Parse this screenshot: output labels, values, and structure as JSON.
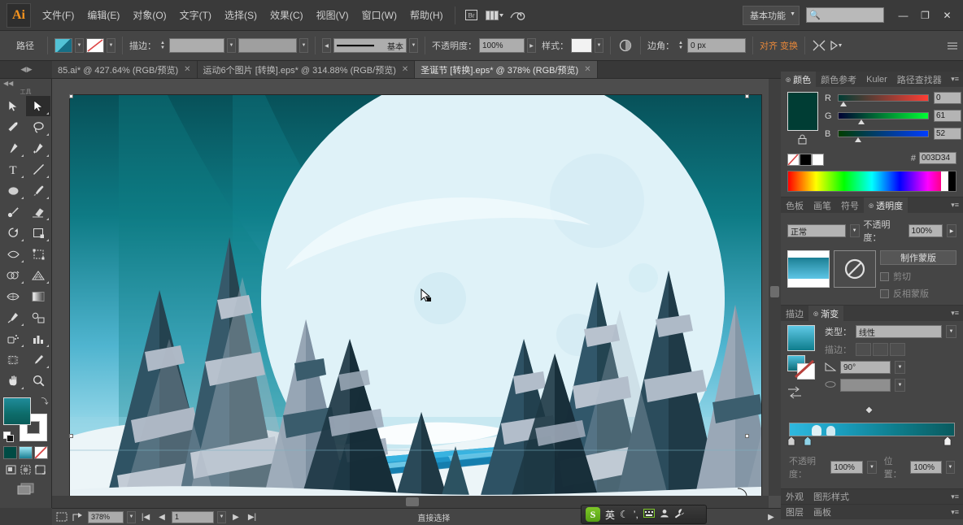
{
  "app": {
    "name": "Ai",
    "workspace": "基本功能",
    "search_placeholder": ""
  },
  "menubar": {
    "items": [
      {
        "label": "文件(F)"
      },
      {
        "label": "编辑(E)"
      },
      {
        "label": "对象(O)"
      },
      {
        "label": "文字(T)"
      },
      {
        "label": "选择(S)"
      },
      {
        "label": "效果(C)"
      },
      {
        "label": "视图(V)"
      },
      {
        "label": "窗口(W)"
      },
      {
        "label": "帮助(H)"
      }
    ],
    "bridge_icon": "bridge-icon",
    "arrange_icon": "arrange-documents-icon",
    "stock_icon": "stock-icon",
    "window_buttons": {
      "minimize": "—",
      "restore": "❐",
      "close": "✕"
    }
  },
  "controlbar": {
    "object_label": "路径",
    "fill_color": "#2a8f9e",
    "stroke_icon": "stroke-none-icon",
    "stroke_weight_label": "描边：",
    "stroke_weight_value": "",
    "profile_value": "",
    "brush_label": "",
    "brush_value": "基本",
    "opacity_label": "不透明度：",
    "opacity_value": "100%",
    "style_label": "样式：",
    "style_value": "",
    "recolor_icon": "recolor-artwork-icon",
    "corner_label": "边角：",
    "corner_value": "0 px",
    "align_label": "对齐",
    "transform_label": "变换",
    "isolate_icon": "isolate-selected-icon",
    "mask_icon": "draw-mode-icon",
    "panel_menu_icon": "panel-menu-icon"
  },
  "tabs": [
    {
      "title": "85.ai* @ 427.64% (RGB/预览)",
      "active": false,
      "close": "✕"
    },
    {
      "title": "运动6个图片 [转换].eps* @ 314.88% (RGB/预览)",
      "active": false,
      "close": "✕"
    },
    {
      "title": "圣诞节 [转换].eps* @ 378% (RGB/预览)",
      "active": true,
      "close": "✕"
    }
  ],
  "toolbox": {
    "title": "工具",
    "tools": [
      {
        "name": "selection-tool",
        "glyph": "selection",
        "selected": false
      },
      {
        "name": "direct-selection-tool",
        "glyph": "direct-selection",
        "selected": true
      },
      {
        "name": "magic-wand-tool",
        "glyph": "magic-wand",
        "selected": false
      },
      {
        "name": "lasso-tool",
        "glyph": "lasso",
        "selected": false
      },
      {
        "name": "pen-tool",
        "glyph": "pen",
        "selected": false
      },
      {
        "name": "add-anchor-point-tool",
        "glyph": "pen-add",
        "selected": false
      },
      {
        "name": "type-tool",
        "glyph": "type",
        "selected": false
      },
      {
        "name": "line-segment-tool",
        "glyph": "line",
        "selected": false
      },
      {
        "name": "ellipse-tool",
        "glyph": "ellipse",
        "selected": false
      },
      {
        "name": "paintbrush-tool",
        "glyph": "brush",
        "selected": false
      },
      {
        "name": "blob-brush-tool",
        "glyph": "blob-brush",
        "selected": false
      },
      {
        "name": "eraser-tool",
        "glyph": "eraser",
        "selected": false
      },
      {
        "name": "rotate-tool",
        "glyph": "rotate",
        "selected": false
      },
      {
        "name": "scale-tool",
        "glyph": "scale",
        "selected": false
      },
      {
        "name": "width-tool",
        "glyph": "width",
        "selected": false
      },
      {
        "name": "free-transform-tool",
        "glyph": "free-transform",
        "selected": false
      },
      {
        "name": "shape-builder-tool",
        "glyph": "shape-builder",
        "selected": false
      },
      {
        "name": "perspective-grid-tool",
        "glyph": "perspective-grid",
        "selected": false
      },
      {
        "name": "mesh-tool",
        "glyph": "mesh",
        "selected": false
      },
      {
        "name": "gradient-tool",
        "glyph": "gradient",
        "selected": false
      },
      {
        "name": "eyedropper-tool",
        "glyph": "eyedropper",
        "selected": false
      },
      {
        "name": "blend-tool",
        "glyph": "blend",
        "selected": false
      },
      {
        "name": "symbol-sprayer-tool",
        "glyph": "symbol-sprayer",
        "selected": false
      },
      {
        "name": "column-graph-tool",
        "glyph": "column-graph",
        "selected": false
      },
      {
        "name": "artboard-tool",
        "glyph": "artboard",
        "selected": false
      },
      {
        "name": "slice-tool",
        "glyph": "slice",
        "selected": false
      },
      {
        "name": "hand-tool",
        "glyph": "hand",
        "selected": false
      },
      {
        "name": "zoom-tool",
        "glyph": "zoom",
        "selected": false
      }
    ],
    "fill_color": "#0d6c6a",
    "stroke_color": "#ffffff",
    "draw_modes": [
      "normal-drawing",
      "draw-behind",
      "draw-inside"
    ],
    "screen_modes": [
      "screen-mode-normal",
      "screen-mode-full-menu",
      "screen-mode-full"
    ]
  },
  "canvas": {
    "artwork_title": "christmas-winter-forest-illustration",
    "zoom": "378%",
    "sky_top": "#0b5c62",
    "sky_bottom": "#8fd3e8",
    "moon_color": "#ddf1f7",
    "tree_dark": "#2b4754",
    "tree_snow": "#b9c3ce",
    "river_color": "#2aa6d4"
  },
  "statusbar": {
    "zoom_value": "378%",
    "page_value": "1",
    "status_text": "直接选择",
    "first_icon": "artboard-fit-icon",
    "share_icon": "share-icon",
    "nav_first": "|◀",
    "nav_prev": "◀",
    "nav_next": "▶",
    "nav_last": "▶|",
    "arrow": "▶"
  },
  "ime": {
    "logo": "S",
    "mode": "英",
    "items": [
      "moon-icon",
      "comma-icon",
      "soft-keyboard-icon",
      "user-icon",
      "tools-icon"
    ]
  },
  "panels": {
    "color": {
      "tabs": [
        {
          "label": "颜色",
          "active": true
        },
        {
          "label": "颜色参考",
          "active": false
        },
        {
          "label": "Kuler",
          "active": false
        },
        {
          "label": "路径查找器",
          "active": false
        }
      ],
      "swatch": "#003d34",
      "channels": [
        {
          "label": "R",
          "value": "0",
          "pos": 2
        },
        {
          "label": "G",
          "value": "61",
          "pos": 24
        },
        {
          "label": "B",
          "value": "52",
          "pos": 20
        }
      ],
      "hex_label": "#",
      "hex_value": "003D34",
      "none_swatch": "none-swatch",
      "black_swatch": "#000000",
      "white_swatch": "#ffffff"
    },
    "transparency": {
      "tabs": [
        {
          "label": "色板",
          "active": false
        },
        {
          "label": "画笔",
          "active": false
        },
        {
          "label": "符号",
          "active": false
        },
        {
          "label": "透明度",
          "active": true
        }
      ],
      "blend_mode": "正常",
      "opacity_label": "不透明度：",
      "opacity_value": "100%",
      "make_mask_button": "制作蒙版",
      "clip_checkbox": "剪切",
      "invert_checkbox": "反相蒙版"
    },
    "gradient": {
      "tabs": [
        {
          "label": "描边",
          "active": false
        },
        {
          "label": "渐变",
          "active": true
        }
      ],
      "type_label": "类型：",
      "type_value": "线性",
      "stroke_label": "描边：",
      "angle_label": "角度",
      "angle_value": "90°",
      "aspect_label": "长宽比",
      "aspect_value": "",
      "opacity_label": "不透明度：",
      "opacity_value": "100%",
      "location_label": "位置：",
      "location_value": "100%",
      "gradient_from": "#2fb8df",
      "gradient_to": "#0a5a5e"
    },
    "appearance": {
      "tabs": [
        {
          "label": "外观",
          "active": false
        },
        {
          "label": "图形样式",
          "active": false
        }
      ]
    },
    "layers": {
      "tabs": [
        {
          "label": "图层",
          "active": false
        },
        {
          "label": "画板",
          "active": false
        }
      ]
    }
  }
}
